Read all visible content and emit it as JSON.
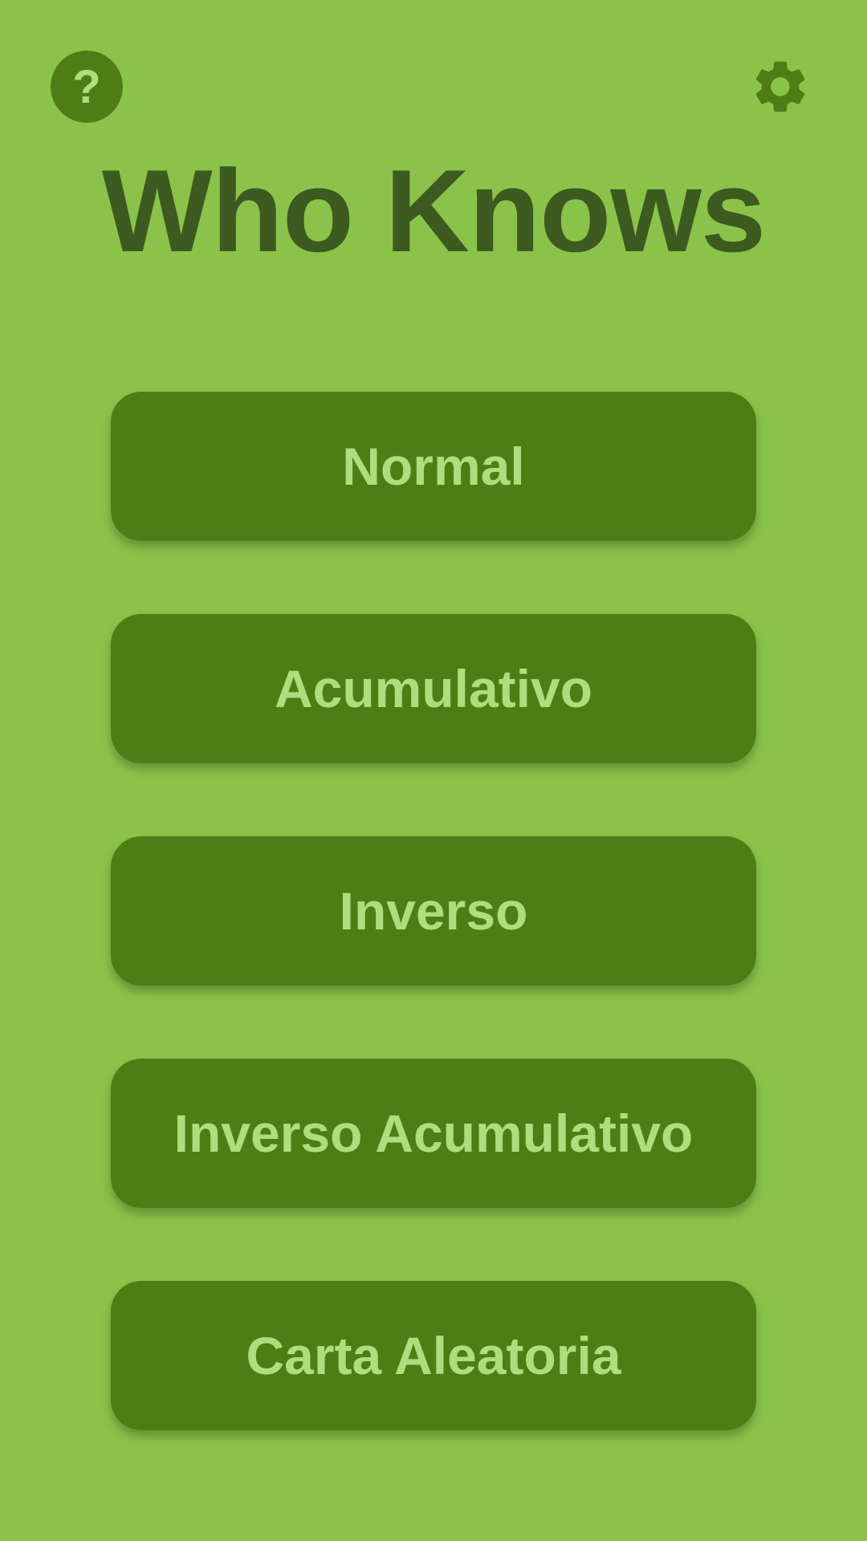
{
  "app": {
    "title": "Who Knows"
  },
  "toolbar": {
    "help_icon": "help-icon",
    "help_glyph": "?",
    "settings_icon": "gear-icon"
  },
  "modes": [
    {
      "label": "Normal"
    },
    {
      "label": "Acumulativo"
    },
    {
      "label": "Inverso"
    },
    {
      "label": "Inverso Acumulativo"
    },
    {
      "label": "Carta Aleatoria"
    }
  ],
  "colors": {
    "background": "#8BC34A",
    "button": "#4E7D15",
    "button_text": "#AEDD7E",
    "title": "#3D5A20"
  }
}
